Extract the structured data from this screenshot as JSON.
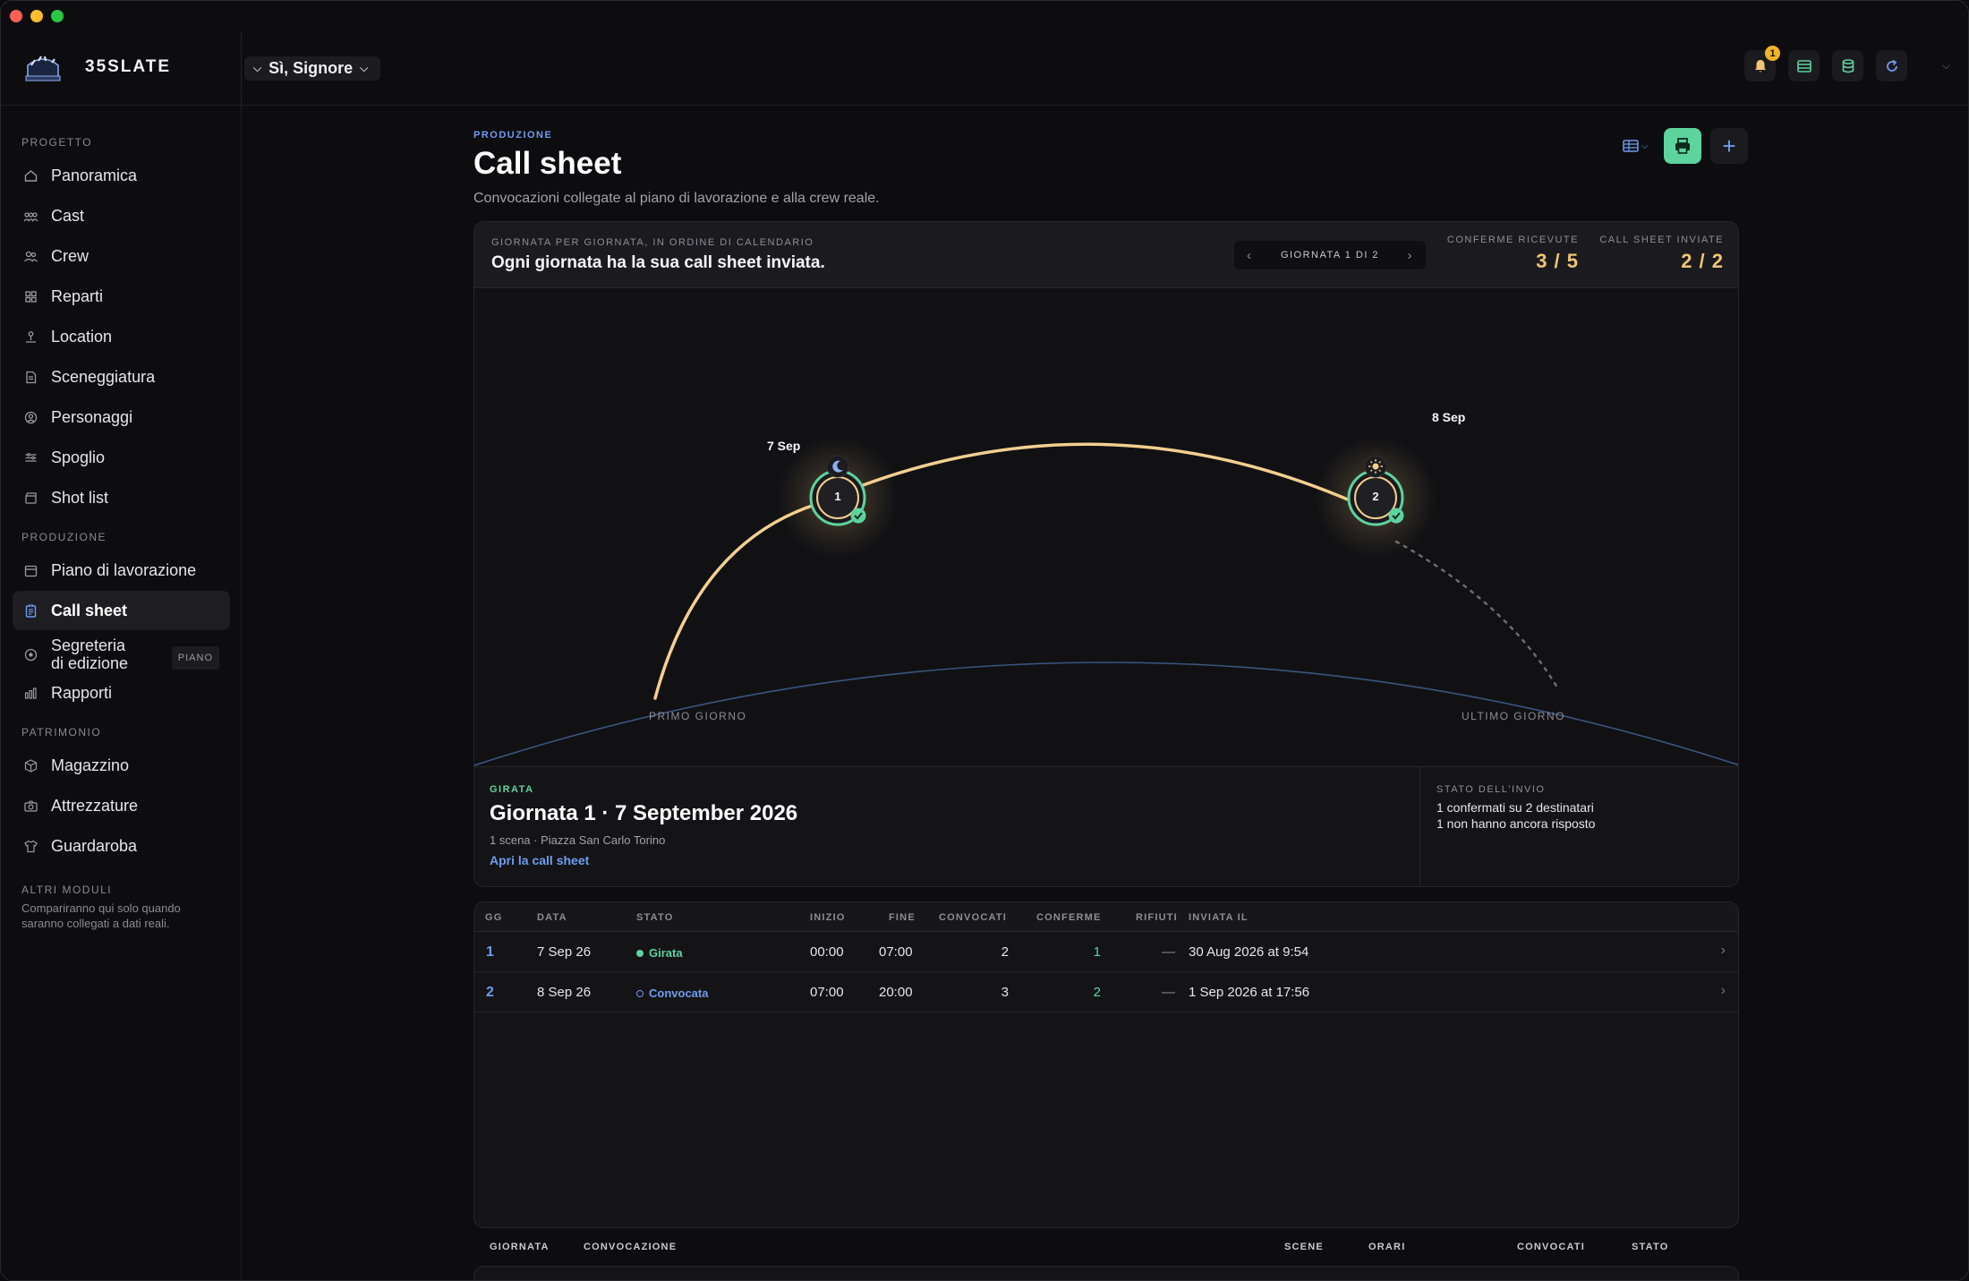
{
  "app": {
    "brand": "35SLATE",
    "project": "Sì, Signore",
    "notifications": "1",
    "colors": {
      "accent": "#6f9cf0",
      "success": "#5dd39e",
      "highlight": "#f0c674",
      "background": "#0d0d0f"
    }
  },
  "sidebar": {
    "sections": [
      {
        "label": "PROGETTO",
        "items": [
          {
            "label": "Panoramica",
            "icon": "home-icon"
          },
          {
            "label": "Cast",
            "icon": "users-icon"
          },
          {
            "label": "Crew",
            "icon": "users-icon"
          },
          {
            "label": "Reparti",
            "icon": "grid-icon"
          },
          {
            "label": "Location",
            "icon": "pin-icon"
          },
          {
            "label": "Sceneggiatura",
            "icon": "document-icon"
          },
          {
            "label": "Personaggi",
            "icon": "user-circle-icon"
          },
          {
            "label": "Spoglio",
            "icon": "sliders-icon"
          },
          {
            "label": "Shot list",
            "icon": "clapper-icon"
          }
        ]
      },
      {
        "label": "PRODUZIONE",
        "items": [
          {
            "label": "Piano di lavorazione",
            "icon": "calendar-icon"
          },
          {
            "label": "Call sheet",
            "icon": "clipboard-icon",
            "active": true
          },
          {
            "label_1": "Segreteria",
            "label_2": "di edizione",
            "badge": "PIANO",
            "icon": "target-icon"
          },
          {
            "label": "Rapporti",
            "icon": "bar-chart-icon"
          }
        ]
      },
      {
        "label": "PATRIMONIO",
        "items": [
          {
            "label": "Magazzino",
            "icon": "box-icon"
          },
          {
            "label": "Attrezzature",
            "icon": "camera-icon"
          },
          {
            "label": "Guardaroba",
            "icon": "shirt-icon"
          }
        ]
      },
      {
        "label": "ALTRI MODULI",
        "text": "Compariranno qui solo quando saranno collegati a dati reali."
      }
    ]
  },
  "main": {
    "eyebrow": "PRODUZIONE",
    "title": "Call sheet",
    "subtitle": "Convocazioni collegate al piano di lavorazione e alla crew reale.",
    "add_label": "+"
  },
  "panel": {
    "eyebrow": "GIORNATA PER GIORNATA, IN ORDINE DI CALENDARIO",
    "title": "Ogni giornata ha la sua call sheet inviata.",
    "day_nav": "GIORNATA 1 DI 2",
    "stats": [
      {
        "label": "CONFERME RICEVUTE",
        "value": "3 / 5"
      },
      {
        "label": "CALL SHEET INVIATE",
        "value": "2 / 2"
      }
    ],
    "days": [
      {
        "number": "1",
        "date": "7 Sep",
        "icon": "moon-icon"
      },
      {
        "number": "2",
        "date": "8 Sep",
        "icon": "sun-icon"
      }
    ],
    "first_label": "PRIMO GIORNO",
    "last_label": "ULTIMO GIORNO"
  },
  "detail": {
    "status": "GIRATA",
    "title": "Giornata 1 · 7 September 2026",
    "meta": "1 scena · Piazza San Carlo Torino",
    "link": "Apri la call sheet",
    "send_label": "STATO DELL'INVIO",
    "send_line1": "1 confermati su 2 destinatari",
    "send_line2": "1 non hanno ancora risposto"
  },
  "table": {
    "headers": [
      "GG",
      "DATA",
      "STATO",
      "INIZIO",
      "FINE",
      "CONVOCATI",
      "CONFERME",
      "RIFIUTI",
      "INVIATA IL"
    ],
    "rows": [
      {
        "gg": "1",
        "data": "7 Sep 26",
        "stato": "Girata",
        "inizio": "00:00",
        "fine": "07:00",
        "convocati": "2",
        "conferme": "1",
        "rifiuti": "—",
        "inviata": "30 Aug 2026 at 9:54"
      },
      {
        "gg": "2",
        "data": "8 Sep 26",
        "stato": "Convocata",
        "inizio": "07:00",
        "fine": "20:00",
        "convocati": "3",
        "conferme": "2",
        "rifiuti": "—",
        "inviata": "1 Sep 2026 at 17:56"
      }
    ]
  },
  "footer_table": {
    "headers": [
      "GIORNATA",
      "CONVOCAZIONE",
      "SCENE",
      "ORARI",
      "CONVOCATI",
      "STATO"
    ]
  }
}
